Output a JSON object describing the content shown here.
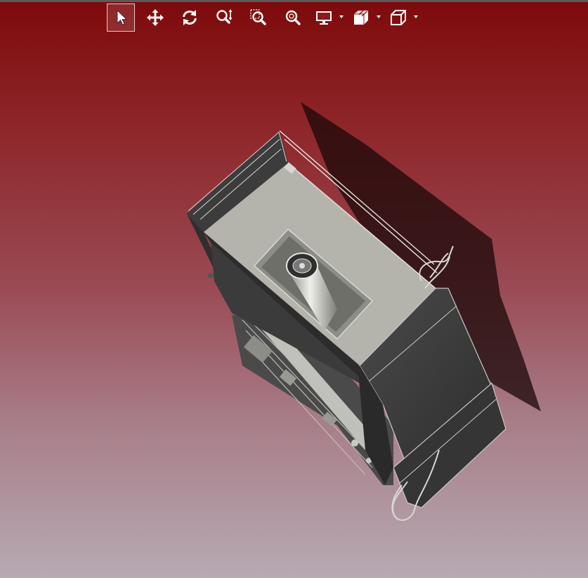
{
  "toolbar": {
    "tools": [
      {
        "name": "select-tool",
        "icon": "cursor-arrow-icon",
        "active": true
      },
      {
        "name": "pan-tool",
        "icon": "move-arrows-icon",
        "active": false
      },
      {
        "name": "rotate-tool",
        "icon": "rotate-icon",
        "active": false
      },
      {
        "name": "zoom-in-out-tool",
        "icon": "zoom-updown-icon",
        "active": false
      },
      {
        "name": "zoom-window-tool",
        "icon": "zoom-window-icon",
        "active": false
      },
      {
        "name": "zoom-fit-tool",
        "icon": "zoom-fit-icon",
        "active": false
      },
      {
        "name": "display-mode-dropdown",
        "icon": "monitor-icon",
        "dropdown": true
      },
      {
        "name": "section-view-dropdown",
        "icon": "section-view-icon",
        "dropdown": true
      },
      {
        "name": "view-orientation-dropdown",
        "icon": "cube-view-icon",
        "dropdown": true
      }
    ]
  },
  "colors": {
    "background_top": "#7e0a0b",
    "background_bottom": "#b7aab3",
    "icon": "#ffffff",
    "model_dark": "#3a3a3a",
    "model_light": "#b5b5ae"
  }
}
